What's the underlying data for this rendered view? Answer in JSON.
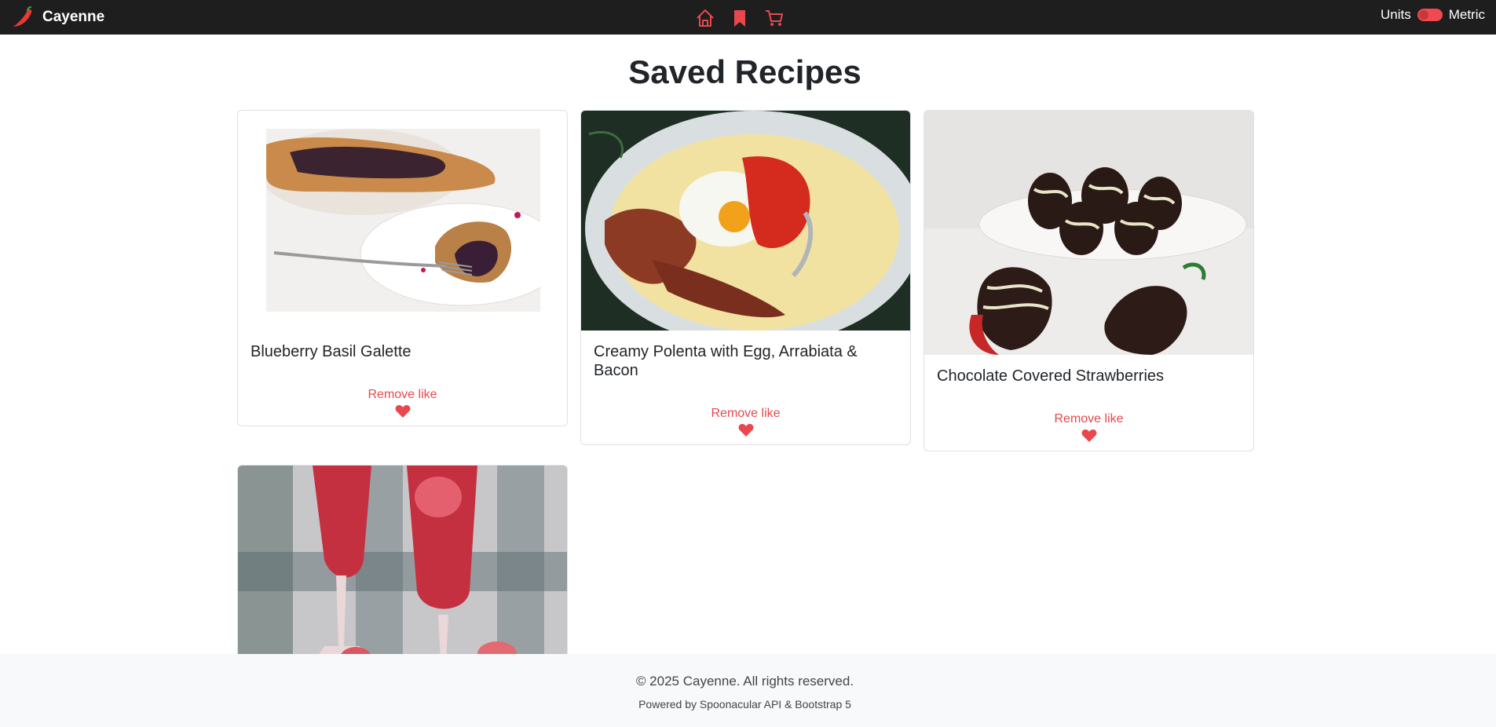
{
  "brand": {
    "name": "Cayenne"
  },
  "nav": {
    "icons": [
      "home-icon",
      "bookmark-icon",
      "cart-icon"
    ]
  },
  "units": {
    "label": "Units",
    "value": "Metric"
  },
  "page": {
    "title": "Saved Recipes"
  },
  "recipes": [
    {
      "title": "Blueberry Basil Galette",
      "action": "Remove like"
    },
    {
      "title": "Creamy Polenta with Egg, Arrabiata & Bacon",
      "action": "Remove like"
    },
    {
      "title": "Chocolate Covered Strawberries",
      "action": "Remove like"
    },
    {
      "title": "",
      "action": ""
    }
  ],
  "footer": {
    "copyright": "© 2025 Cayenne. All rights reserved.",
    "powered": "Powered by Spoonacular API & Bootstrap 5"
  },
  "colors": {
    "accent": "#e8484d",
    "navbar": "#1e1e1e",
    "footer": "#f8f9fa"
  }
}
